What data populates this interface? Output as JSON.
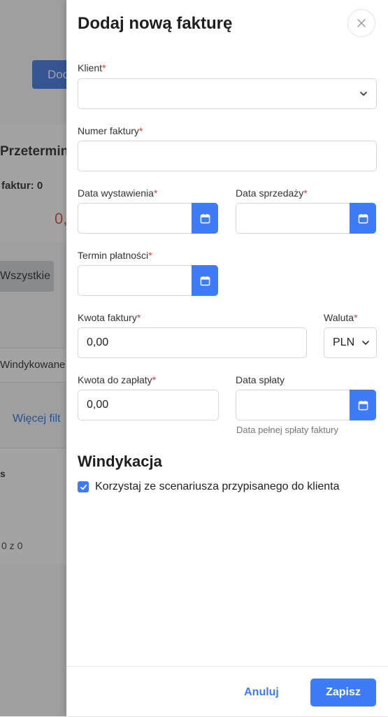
{
  "background": {
    "add_button": "Dod",
    "section_title": "Przetermin",
    "invoice_count": "faktur: 0",
    "amount": "0,",
    "filter_chip": "Wszystkie",
    "tab": "Windykowane",
    "more_filters": "Więcej filt",
    "table_header": "s",
    "pagination": "0 z 0"
  },
  "drawer": {
    "title": "Dodaj nową fakturę",
    "required_mark": "*",
    "fields": {
      "client": {
        "label": "Klient",
        "value": ""
      },
      "invoice_number": {
        "label": "Numer faktury",
        "value": ""
      },
      "issue_date": {
        "label": "Data wystawienia",
        "value": ""
      },
      "sale_date": {
        "label": "Data sprzedaży",
        "value": ""
      },
      "due_date": {
        "label": "Termin płatności",
        "value": ""
      },
      "invoice_amount": {
        "label": "Kwota faktury",
        "value": "0,00"
      },
      "currency": {
        "label": "Waluta",
        "value": "PLN"
      },
      "amount_to_pay": {
        "label": "Kwota do zapłaty",
        "value": "0,00"
      },
      "payment_date": {
        "label": "Data spłaty",
        "value": "",
        "hint": "Data pełnej spłaty faktury"
      }
    },
    "collection": {
      "title": "Windykacja",
      "checkbox_label": "Korzystaj ze scenariusza przypisanego do klienta",
      "checked": true
    },
    "footer": {
      "cancel": "Anuluj",
      "save": "Zapisz"
    }
  },
  "colors": {
    "accent": "#3e7bf6",
    "required": "#e03a3a",
    "bg_button": "#3b6fe0",
    "bg_amount": "#d24a2a"
  }
}
